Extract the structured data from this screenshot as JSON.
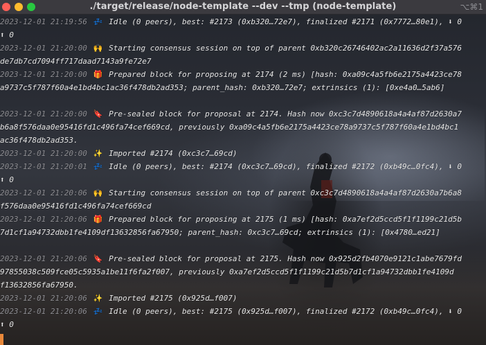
{
  "window": {
    "title": "./target/release/node-template --dev --tmp (node-template)",
    "shortcut": "⌥⌘1",
    "traffic_lights": [
      "close",
      "minimize",
      "zoom"
    ]
  },
  "colors": {
    "timestamp": "#8e8e93",
    "text": "#e8e8e8",
    "cursor": "#e8883a"
  },
  "log": [
    {
      "ts": "2023-12-01 21:19:56",
      "icon": "zzz-icon",
      "text": "Idle (0 peers), best: #2173 (0xb320…72e7), finalized #2171 (0x7772…80e1), ⬇ 0"
    },
    {
      "ts": "",
      "icon": "",
      "text": "⬆ 0"
    },
    {
      "ts": "2023-12-01 21:20:00",
      "icon": "raised-hands-icon",
      "text": "Starting consensus session on top of parent 0xb320c26746402ac2a11636d2f37a576"
    },
    {
      "ts": "",
      "icon": "",
      "text": "de7db7cd7094ff717daad7143a9fe72e7"
    },
    {
      "ts": "2023-12-01 21:20:00",
      "icon": "gift-icon",
      "text": "Prepared block for proposing at 2174 (2 ms) [hash: 0xa09c4a5fb6e2175a4423ce78"
    },
    {
      "ts": "",
      "icon": "",
      "text": "a9737c5f787f60a4e1bd4bc1ac36f478db2ad353; parent_hash: 0xb320…72e7; extrinsics (1): [0xe4a0…5ab6]"
    },
    {
      "ts": "",
      "icon": "",
      "text": ""
    },
    {
      "ts": "2023-12-01 21:20:00",
      "icon": "bookmark-icon",
      "text": "Pre-sealed block for proposal at 2174. Hash now 0xc3c7d4890618a4a4af87d2630a7"
    },
    {
      "ts": "",
      "icon": "",
      "text": "b6a8f576daa0e95416fd1c496fa74cef669cd, previously 0xa09c4a5fb6e2175a4423ce78a9737c5f787f60a4e1bd4bc1"
    },
    {
      "ts": "",
      "icon": "",
      "text": "ac36f478db2ad353."
    },
    {
      "ts": "2023-12-01 21:20:00",
      "icon": "sparkles-icon",
      "text": "Imported #2174 (0xc3c7…69cd)"
    },
    {
      "ts": "2023-12-01 21:20:01",
      "icon": "zzz-icon",
      "text": "Idle (0 peers), best: #2174 (0xc3c7…69cd), finalized #2172 (0xb49c…0fc4), ⬇ 0"
    },
    {
      "ts": "",
      "icon": "",
      "text": "⬆ 0"
    },
    {
      "ts": "2023-12-01 21:20:06",
      "icon": "raised-hands-icon",
      "text": "Starting consensus session on top of parent 0xc3c7d4890618a4a4af87d2630a7b6a8"
    },
    {
      "ts": "",
      "icon": "",
      "text": "f576daa0e95416fd1c496fa74cef669cd"
    },
    {
      "ts": "2023-12-01 21:20:06",
      "icon": "gift-icon",
      "text": "Prepared block for proposing at 2175 (1 ms) [hash: 0xa7ef2d5ccd5f1f1199c21d5b"
    },
    {
      "ts": "",
      "icon": "",
      "text": "7d1cf1a94732dbb1fe4109df13632856fa67950; parent_hash: 0xc3c7…69cd; extrinsics (1): [0x4780…ed21]"
    },
    {
      "ts": "",
      "icon": "",
      "text": ""
    },
    {
      "ts": "2023-12-01 21:20:06",
      "icon": "bookmark-icon",
      "text": "Pre-sealed block for proposal at 2175. Hash now 0x925d2fb4070e9121c1abe7679fd"
    },
    {
      "ts": "",
      "icon": "",
      "text": "97855038c509fce05c5935a1be11f6fa2f007, previously 0xa7ef2d5ccd5f1f1199c21d5b7d1cf1a94732dbb1fe4109d"
    },
    {
      "ts": "",
      "icon": "",
      "text": "f13632856fa67950."
    },
    {
      "ts": "2023-12-01 21:20:06",
      "icon": "sparkles-icon",
      "text": "Imported #2175 (0x925d…f007)"
    },
    {
      "ts": "2023-12-01 21:20:06",
      "icon": "zzz-icon",
      "text": "Idle (0 peers), best: #2175 (0x925d…f007), finalized #2172 (0xb49c…0fc4), ⬇ 0"
    },
    {
      "ts": "",
      "icon": "",
      "text": "⬆ 0"
    }
  ]
}
